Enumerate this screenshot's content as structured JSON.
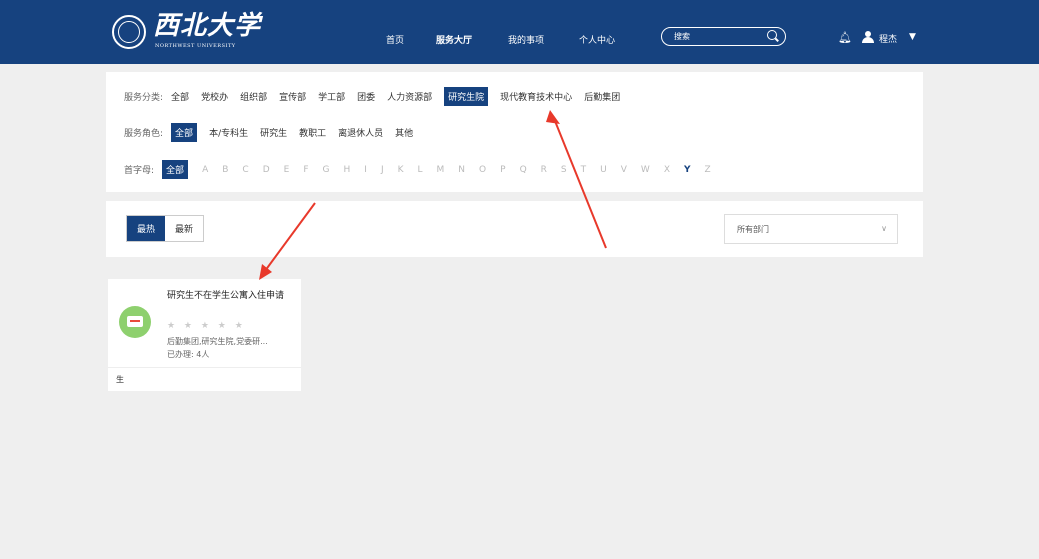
{
  "header": {
    "logo_text": "西北大学",
    "logo_sub": "NORTHWEST UNIVERSITY",
    "nav": [
      "首页",
      "服务大厅",
      "我的事项",
      "个人中心"
    ],
    "search_placeholder": "搜索",
    "user_name": "程杰"
  },
  "filters": {
    "category_label": "服务分类:",
    "categories": [
      "全部",
      "党校办",
      "组织部",
      "宣传部",
      "学工部",
      "团委",
      "人力资源部",
      "研究生院",
      "现代教育技术中心",
      "后勤集团"
    ],
    "role_label": "服务角色:",
    "roles": [
      "全部",
      "本/专科生",
      "研究生",
      "教职工",
      "离退休人员",
      "其他"
    ],
    "letter_label": "首字母:",
    "letter_all": "全部",
    "letters": [
      "A",
      "B",
      "C",
      "D",
      "E",
      "F",
      "G",
      "H",
      "I",
      "J",
      "K",
      "L",
      "M",
      "N",
      "O",
      "P",
      "Q",
      "R",
      "S",
      "T",
      "U",
      "V",
      "W",
      "X",
      "Y",
      "Z"
    ]
  },
  "sort": {
    "hot": "最热",
    "new": "最新",
    "dept_value": "所有部门"
  },
  "card": {
    "title": "研究生不在学生公寓入住申请",
    "stars": "★ ★ ★ ★ ★",
    "dept": "后勤集团,研究生院,党委研...",
    "count": "已办理: 4人",
    "foot": "生"
  },
  "colors": {
    "brand": "#16427f",
    "arrow": "#e8392b"
  }
}
